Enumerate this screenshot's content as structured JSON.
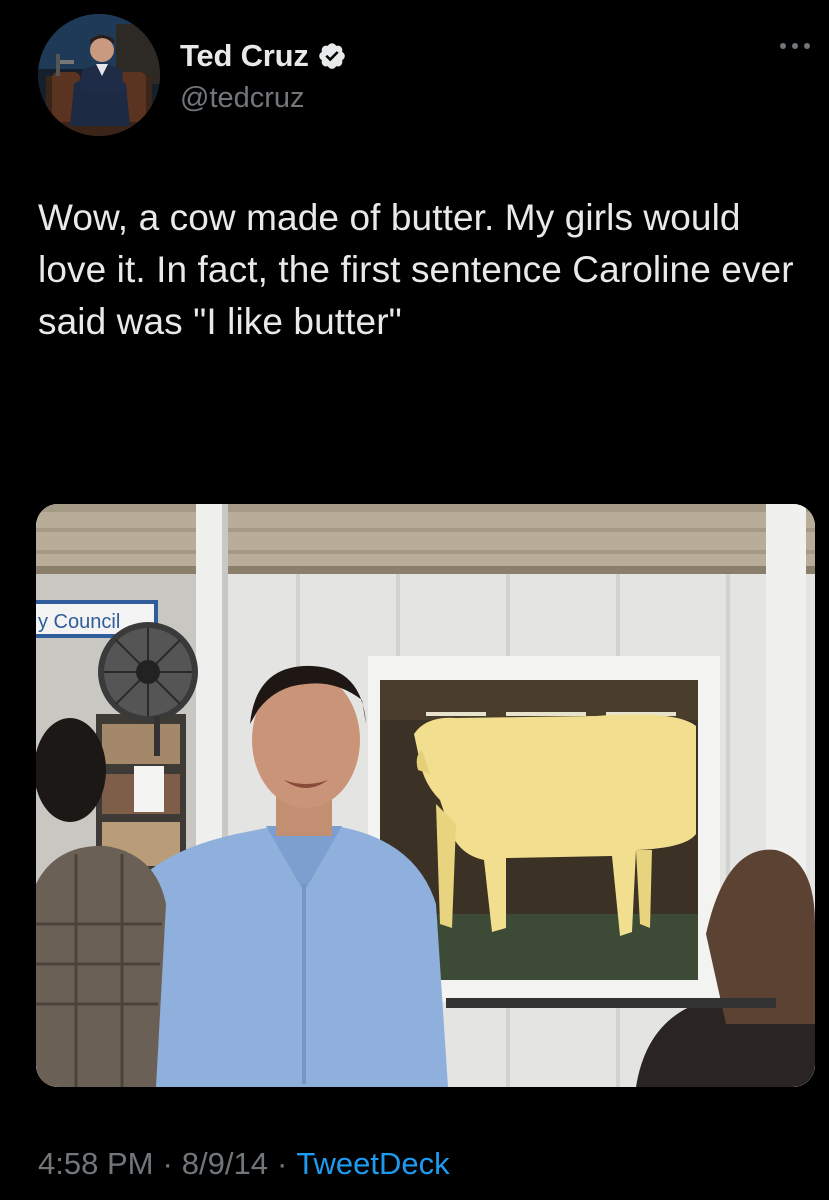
{
  "author": {
    "display_name": "Ted Cruz",
    "handle": "@tedcruz",
    "verified": true
  },
  "tweet": {
    "text": "Wow, a cow made of butter. My girls would love it. In fact, the first sentence Caroline ever said was \"I like butter\""
  },
  "media": {
    "sign_text": "y Council"
  },
  "meta": {
    "time": "4:58 PM",
    "separator": "·",
    "date": "8/9/14",
    "source": "TweetDeck"
  },
  "colors": {
    "background": "#000000",
    "text": "#e7e9ea",
    "secondary": "#71767b",
    "link": "#1d9bf0",
    "verified_badge": "#e7e9ea"
  },
  "icons": {
    "verified": "verified-badge-icon",
    "more": "more-dots-icon"
  }
}
